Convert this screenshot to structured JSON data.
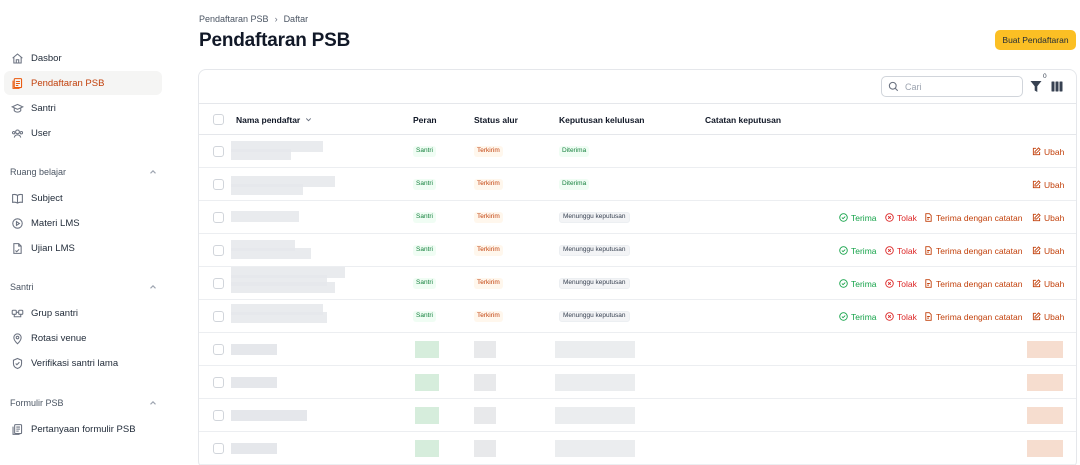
{
  "sidebar": {
    "items": [
      {
        "label": "Dasbor",
        "icon": "home-icon",
        "active": false
      },
      {
        "label": "Pendaftaran PSB",
        "icon": "document-stack-icon",
        "active": true
      },
      {
        "label": "Santri",
        "icon": "graduation-cap-icon",
        "active": false
      },
      {
        "label": "User",
        "icon": "users-icon",
        "active": false
      }
    ],
    "sections": [
      {
        "title": "Ruang belajar",
        "items": [
          {
            "label": "Subject",
            "icon": "book-icon"
          },
          {
            "label": "Materi LMS",
            "icon": "play-circle-icon"
          },
          {
            "label": "Ujian LMS",
            "icon": "exam-file-icon"
          }
        ]
      },
      {
        "title": "Santri",
        "items": [
          {
            "label": "Grup santri",
            "icon": "group-icon"
          },
          {
            "label": "Rotasi venue",
            "icon": "map-pin-icon"
          },
          {
            "label": "Verifikasi santri lama",
            "icon": "verify-badge-icon"
          }
        ]
      },
      {
        "title": "Formulir PSB",
        "items": [
          {
            "label": "Pertanyaan formulir PSB",
            "icon": "form-stack-icon"
          }
        ]
      }
    ]
  },
  "header": {
    "breadcrumb": [
      "Pendaftaran PSB",
      "Daftar"
    ],
    "title": "Pendaftaran PSB",
    "create_button": "Buat Pendaftaran"
  },
  "toolbar": {
    "search_placeholder": "Cari",
    "filter_count": "0"
  },
  "table": {
    "columns": [
      "Nama pendaftar",
      "Peran",
      "Status alur",
      "Keputusan kelulusan",
      "Catatan keputusan"
    ],
    "actions": {
      "accept": "Terima",
      "reject": "Tolak",
      "accept_note": "Terima dengan catatan",
      "edit": "Ubah"
    },
    "rows": [
      {
        "role": "Santri",
        "status": "Terkirim",
        "decision": "Diterima",
        "decision_type": "accepted"
      },
      {
        "role": "Santri",
        "status": "Terkirim",
        "decision": "Diterima",
        "decision_type": "accepted"
      },
      {
        "role": "Santri",
        "status": "Terkirim",
        "decision": "Menunggu keputusan",
        "decision_type": "pending"
      },
      {
        "role": "Santri",
        "status": "Terkirim",
        "decision": "Menunggu keputusan",
        "decision_type": "pending"
      },
      {
        "role": "Santri",
        "status": "Terkirim",
        "decision": "Menunggu keputusan",
        "decision_type": "pending"
      },
      {
        "role": "Santri",
        "status": "Terkirim",
        "decision": "Menunggu keputusan",
        "decision_type": "pending"
      }
    ],
    "placeholder_rows": 4
  },
  "colors": {
    "accent": "#ea580c",
    "primary_button": "#fbbf24",
    "accept": "#16a34a",
    "reject": "#dc2626",
    "edit": "#c2410c"
  }
}
